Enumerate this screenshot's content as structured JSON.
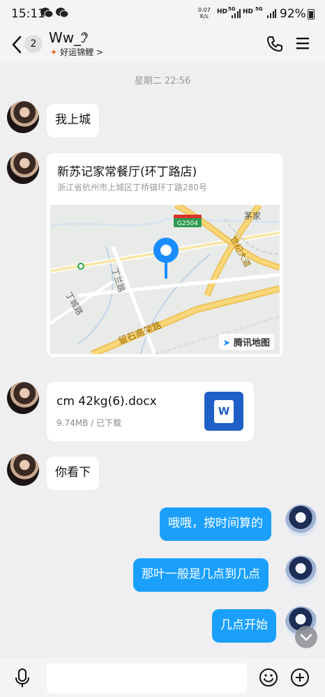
{
  "status_bar": {
    "time": "15:11",
    "net_speed": "0.07",
    "net_unit": "K/s",
    "hd1": "HD",
    "sig1": "5G",
    "hd2": "HD",
    "sig2": "5G",
    "battery": "92%"
  },
  "header": {
    "unread_count": "2",
    "title": "Ww_",
    "subtitle": "好运锦鲤 >",
    "koi_icon": "koi-icon"
  },
  "timestamp": "星期二 22:56",
  "messages": [
    {
      "side": "in",
      "type": "text",
      "text": "我上城"
    },
    {
      "side": "in",
      "type": "location",
      "name": "新苏记家常餐厅(环丁路店)",
      "address": "浙江省杭州市上城区丁桥镇环丁路280号",
      "map_labels": {
        "highway": "G2504",
        "road1": "留石高架路",
        "road2": "世纪大道",
        "road3": "丁城路",
        "road4": "丁兰路",
        "place": "茅家",
        "brand": "腾讯地图"
      }
    },
    {
      "side": "in",
      "type": "file",
      "name": "cm  42kg(6).docx",
      "meta": "9.74MB / 已下载",
      "icon_letter": "W"
    },
    {
      "side": "in",
      "type": "text",
      "text": "你看下"
    },
    {
      "side": "out",
      "type": "text",
      "text": "哦哦，按时间算的"
    },
    {
      "side": "out",
      "type": "text",
      "text": "那叶一般是几点到几点"
    },
    {
      "side": "out",
      "type": "text",
      "text": "几点开始"
    }
  ],
  "input": {
    "value": "",
    "placeholder": ""
  },
  "colors": {
    "outgoing_bubble": "#1aa0fb",
    "background": "#efeff1",
    "file_icon": "#1f5fc8"
  }
}
